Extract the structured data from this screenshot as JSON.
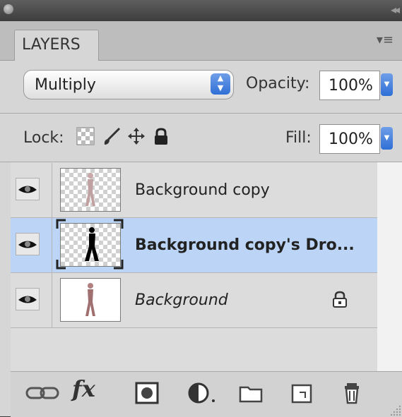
{
  "panel": {
    "tab_label": "LAYERS",
    "menu_icon": "panel-menu-icon"
  },
  "blend": {
    "mode": "Multiply",
    "opacity_label": "Opacity:",
    "opacity_value": "100%"
  },
  "lock": {
    "label": "Lock:",
    "fill_label": "Fill:",
    "fill_value": "100%",
    "icons": [
      "lock-transparency-icon",
      "lock-image-icon",
      "lock-position-icon",
      "lock-all-icon"
    ]
  },
  "layers": [
    {
      "name": "Background copy",
      "visible": true,
      "selected": false,
      "italic": false,
      "locked": false
    },
    {
      "name": "Background copy's Dro...",
      "visible": true,
      "selected": true,
      "italic": false,
      "locked": false
    },
    {
      "name": "Background",
      "visible": true,
      "selected": false,
      "italic": true,
      "locked": true
    }
  ],
  "bottom_toolbar": {
    "fx_label": "fx",
    "icons": [
      "link-layers-icon",
      "layer-style-icon",
      "add-mask-icon",
      "adjustment-layer-icon",
      "new-group-icon",
      "new-layer-icon",
      "delete-layer-icon"
    ]
  },
  "colors": {
    "selection": "#bcd5f6",
    "accent_blue": "#2f6fd6"
  }
}
